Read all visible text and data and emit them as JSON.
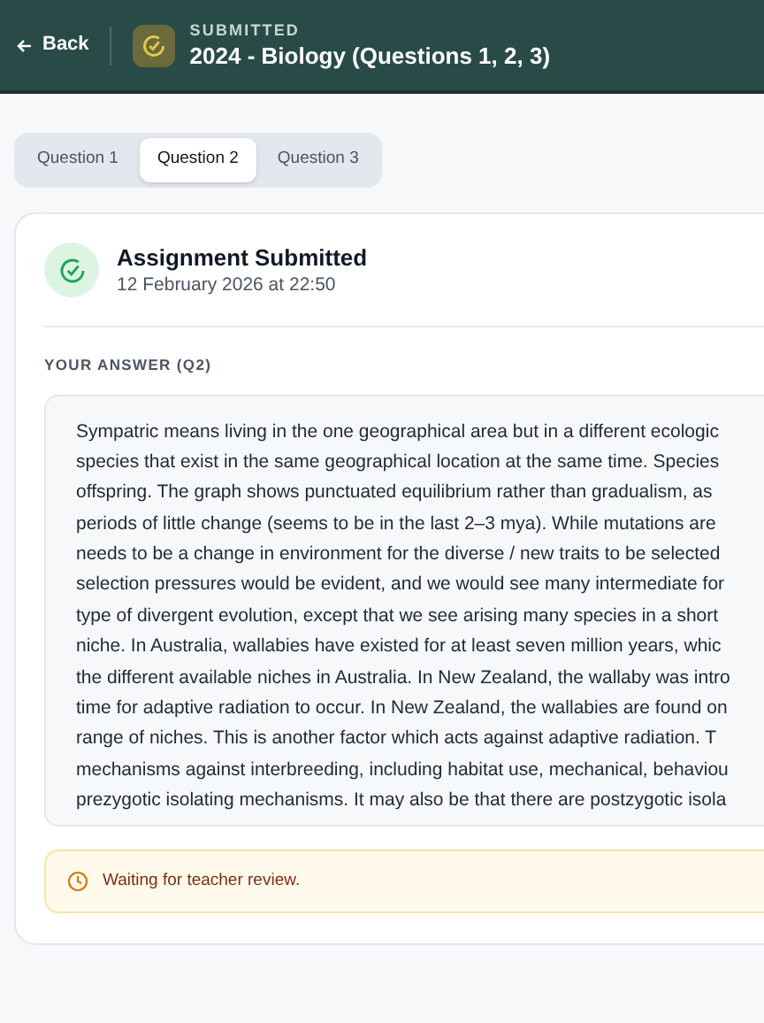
{
  "header": {
    "back": "Back",
    "status": "SUBMITTED",
    "title": "2024 - Biology (Questions 1, 2, 3)"
  },
  "tabs": [
    {
      "label": "Question 1",
      "selected": false
    },
    {
      "label": "Question 2",
      "selected": true
    },
    {
      "label": "Question 3",
      "selected": false
    }
  ],
  "submission": {
    "title": "Assignment Submitted",
    "date": "12 February 2026 at 22:50"
  },
  "answer": {
    "heading": "YOUR ANSWER (Q2)",
    "lines": [
      "Sympatric means living in the one geographical area but in a different ecologic",
      "species that exist in the same geographical location at the same time. Species",
      "offspring. The graph shows punctuated equilibrium rather than gradualism, as",
      "periods of little change (seems to be in the last 2–3 mya). While mutations are",
      "needs to be a change in environment for the diverse / new traits to be selected",
      "selection pressures would be evident, and we would see many intermediate for",
      "type of divergent evolution, except that we see arising many species in a short",
      "niche. In Australia, wallabies have existed for at least seven million years, whic",
      "the different available niches in Australia. In New Zealand, the wallaby was intro",
      "time for adaptive radiation to occur. In New Zealand, the wallabies are found on",
      "range of niches. This is another factor which acts against adaptive radiation. T",
      "mechanisms against interbreeding, including habitat use, mechanical, behaviou",
      "prezygotic isolating mechanisms. It may also be that there are postzygotic isola"
    ]
  },
  "notice": {
    "text": "Waiting for teacher review."
  }
}
